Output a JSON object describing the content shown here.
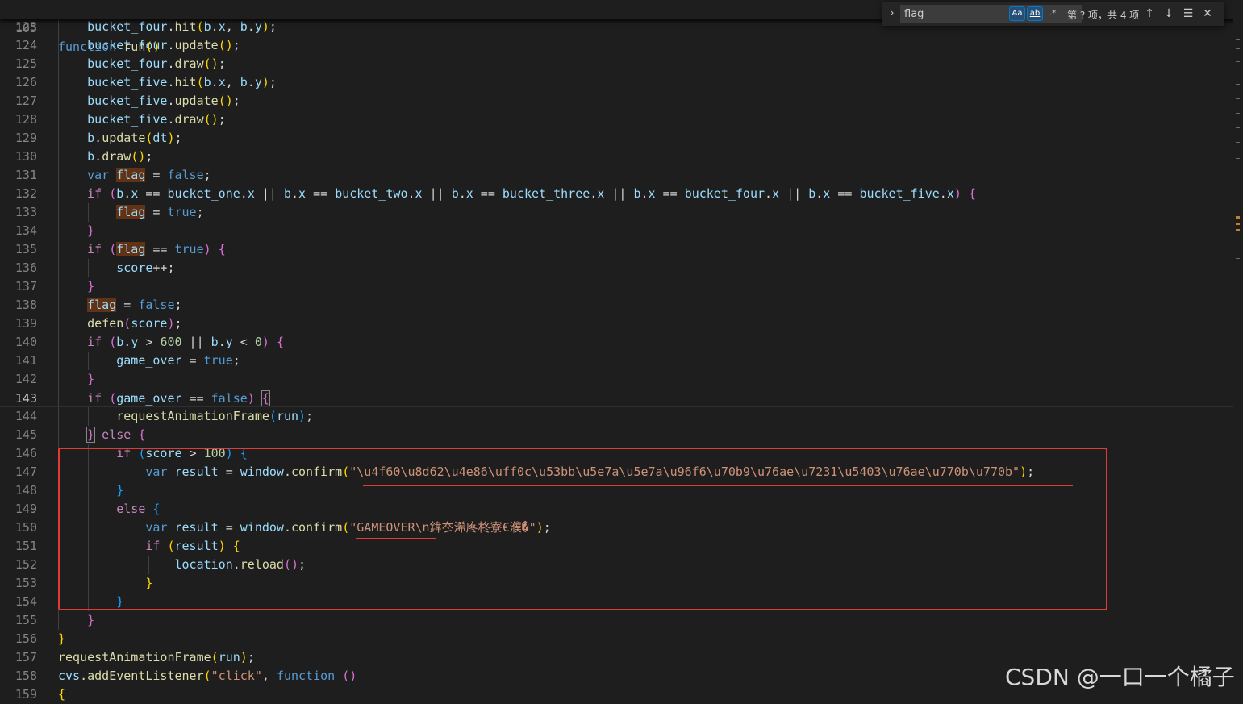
{
  "sticky": {
    "line": "105",
    "keyword": "function",
    "name": "run",
    "parens": "()"
  },
  "lines": [
    {
      "n": "123",
      "indent": 1,
      "tokens": [
        [
          "var",
          "bucket_four"
        ],
        [
          "op",
          "."
        ],
        [
          "fn",
          "hit"
        ],
        [
          "br1",
          "("
        ],
        [
          "var",
          "b"
        ],
        [
          "op",
          "."
        ],
        [
          "var",
          "x"
        ],
        [
          "op",
          ", "
        ],
        [
          "var",
          "b"
        ],
        [
          "op",
          "."
        ],
        [
          "var",
          "y"
        ],
        [
          "br1",
          ")"
        ],
        [
          "op",
          ";"
        ]
      ]
    },
    {
      "n": "124",
      "indent": 1,
      "tokens": [
        [
          "var",
          "bucket_four"
        ],
        [
          "op",
          "."
        ],
        [
          "fn",
          "update"
        ],
        [
          "br1",
          "()"
        ],
        [
          "op",
          ";"
        ]
      ]
    },
    {
      "n": "125",
      "indent": 1,
      "tokens": [
        [
          "var",
          "bucket_four"
        ],
        [
          "op",
          "."
        ],
        [
          "fn",
          "draw"
        ],
        [
          "br1",
          "()"
        ],
        [
          "op",
          ";"
        ]
      ]
    },
    {
      "n": "126",
      "indent": 1,
      "tokens": [
        [
          "var",
          "bucket_five"
        ],
        [
          "op",
          "."
        ],
        [
          "fn",
          "hit"
        ],
        [
          "br1",
          "("
        ],
        [
          "var",
          "b"
        ],
        [
          "op",
          "."
        ],
        [
          "var",
          "x"
        ],
        [
          "op",
          ", "
        ],
        [
          "var",
          "b"
        ],
        [
          "op",
          "."
        ],
        [
          "var",
          "y"
        ],
        [
          "br1",
          ")"
        ],
        [
          "op",
          ";"
        ]
      ]
    },
    {
      "n": "127",
      "indent": 1,
      "tokens": [
        [
          "var",
          "bucket_five"
        ],
        [
          "op",
          "."
        ],
        [
          "fn",
          "update"
        ],
        [
          "br1",
          "()"
        ],
        [
          "op",
          ";"
        ]
      ]
    },
    {
      "n": "128",
      "indent": 1,
      "tokens": [
        [
          "var",
          "bucket_five"
        ],
        [
          "op",
          "."
        ],
        [
          "fn",
          "draw"
        ],
        [
          "br1",
          "()"
        ],
        [
          "op",
          ";"
        ]
      ]
    },
    {
      "n": "129",
      "indent": 1,
      "tokens": [
        [
          "var",
          "b"
        ],
        [
          "op",
          "."
        ],
        [
          "fn",
          "update"
        ],
        [
          "br1",
          "("
        ],
        [
          "var",
          "dt"
        ],
        [
          "br1",
          ")"
        ],
        [
          "op",
          ";"
        ]
      ]
    },
    {
      "n": "130",
      "indent": 1,
      "tokens": [
        [
          "var",
          "b"
        ],
        [
          "op",
          "."
        ],
        [
          "fn",
          "draw"
        ],
        [
          "br1",
          "()"
        ],
        [
          "op",
          ";"
        ]
      ]
    },
    {
      "n": "131",
      "indent": 1,
      "tokens": [
        [
          "kw",
          "var "
        ],
        [
          "var-hl",
          "flag"
        ],
        [
          "op",
          " = "
        ],
        [
          "kw",
          "false"
        ],
        [
          "op",
          ";"
        ]
      ]
    },
    {
      "n": "132",
      "indent": 1,
      "tokens": [
        [
          "ctl",
          "if "
        ],
        [
          "br2",
          "("
        ],
        [
          "var",
          "b"
        ],
        [
          "op",
          "."
        ],
        [
          "var",
          "x"
        ],
        [
          "op",
          " == "
        ],
        [
          "var",
          "bucket_one"
        ],
        [
          "op",
          "."
        ],
        [
          "var",
          "x"
        ],
        [
          "op",
          " || "
        ],
        [
          "var",
          "b"
        ],
        [
          "op",
          "."
        ],
        [
          "var",
          "x"
        ],
        [
          "op",
          " == "
        ],
        [
          "var",
          "bucket_two"
        ],
        [
          "op",
          "."
        ],
        [
          "var",
          "x"
        ],
        [
          "op",
          " || "
        ],
        [
          "var",
          "b"
        ],
        [
          "op",
          "."
        ],
        [
          "var",
          "x"
        ],
        [
          "op",
          " == "
        ],
        [
          "var",
          "bucket_three"
        ],
        [
          "op",
          "."
        ],
        [
          "var",
          "x"
        ],
        [
          "op",
          " || "
        ],
        [
          "var",
          "b"
        ],
        [
          "op",
          "."
        ],
        [
          "var",
          "x"
        ],
        [
          "op",
          " == "
        ],
        [
          "var",
          "bucket_four"
        ],
        [
          "op",
          "."
        ],
        [
          "var",
          "x"
        ],
        [
          "op",
          " || "
        ],
        [
          "var",
          "b"
        ],
        [
          "op",
          "."
        ],
        [
          "var",
          "x"
        ],
        [
          "op",
          " == "
        ],
        [
          "var",
          "bucket_five"
        ],
        [
          "op",
          "."
        ],
        [
          "var",
          "x"
        ],
        [
          "br2",
          ")"
        ],
        [
          "op",
          " "
        ],
        [
          "br2",
          "{"
        ]
      ]
    },
    {
      "n": "133",
      "indent": 2,
      "tokens": [
        [
          "var-hl",
          "flag"
        ],
        [
          "op",
          " = "
        ],
        [
          "kw",
          "true"
        ],
        [
          "op",
          ";"
        ]
      ]
    },
    {
      "n": "134",
      "indent": 1,
      "tokens": [
        [
          "br2",
          "}"
        ]
      ]
    },
    {
      "n": "135",
      "indent": 1,
      "tokens": [
        [
          "ctl",
          "if "
        ],
        [
          "br2",
          "("
        ],
        [
          "var-hl",
          "flag"
        ],
        [
          "op",
          " == "
        ],
        [
          "kw",
          "true"
        ],
        [
          "br2",
          ")"
        ],
        [
          "op",
          " "
        ],
        [
          "br2",
          "{"
        ]
      ]
    },
    {
      "n": "136",
      "indent": 2,
      "tokens": [
        [
          "var",
          "score"
        ],
        [
          "op",
          "++;"
        ]
      ]
    },
    {
      "n": "137",
      "indent": 1,
      "tokens": [
        [
          "br2",
          "}"
        ]
      ]
    },
    {
      "n": "138",
      "indent": 1,
      "tokens": [
        [
          "var-hl",
          "flag"
        ],
        [
          "op",
          " = "
        ],
        [
          "kw",
          "false"
        ],
        [
          "op",
          ";"
        ]
      ]
    },
    {
      "n": "139",
      "indent": 1,
      "tokens": [
        [
          "fn",
          "defen"
        ],
        [
          "br2",
          "("
        ],
        [
          "var",
          "score"
        ],
        [
          "br2",
          ")"
        ],
        [
          "op",
          ";"
        ]
      ]
    },
    {
      "n": "140",
      "indent": 1,
      "tokens": [
        [
          "ctl",
          "if "
        ],
        [
          "br2",
          "("
        ],
        [
          "var",
          "b"
        ],
        [
          "op",
          "."
        ],
        [
          "var",
          "y"
        ],
        [
          "op",
          " > "
        ],
        [
          "num",
          "600"
        ],
        [
          "op",
          " || "
        ],
        [
          "var",
          "b"
        ],
        [
          "op",
          "."
        ],
        [
          "var",
          "y"
        ],
        [
          "op",
          " < "
        ],
        [
          "num",
          "0"
        ],
        [
          "br2",
          ")"
        ],
        [
          "op",
          " "
        ],
        [
          "br2",
          "{"
        ]
      ]
    },
    {
      "n": "141",
      "indent": 2,
      "tokens": [
        [
          "var",
          "game_over"
        ],
        [
          "op",
          " = "
        ],
        [
          "kw",
          "true"
        ],
        [
          "op",
          ";"
        ]
      ]
    },
    {
      "n": "142",
      "indent": 1,
      "tokens": [
        [
          "br2",
          "}"
        ]
      ]
    },
    {
      "n": "143",
      "indent": 1,
      "active": true,
      "tokens": [
        [
          "ctl",
          "if "
        ],
        [
          "br2",
          "("
        ],
        [
          "var",
          "game_over"
        ],
        [
          "op",
          " == "
        ],
        [
          "kw",
          "false"
        ],
        [
          "br2",
          ")"
        ],
        [
          "op",
          " "
        ],
        [
          "br2-m",
          "{"
        ]
      ]
    },
    {
      "n": "144",
      "indent": 2,
      "tokens": [
        [
          "fn",
          "requestAnimationFrame"
        ],
        [
          "br3",
          "("
        ],
        [
          "var",
          "run"
        ],
        [
          "br3",
          ")"
        ],
        [
          "op",
          ";"
        ]
      ]
    },
    {
      "n": "145",
      "indent": 1,
      "tokens": [
        [
          "br2-m",
          "}"
        ],
        [
          "ctl",
          " else "
        ],
        [
          "br2",
          "{"
        ]
      ]
    },
    {
      "n": "146",
      "indent": 2,
      "tokens": [
        [
          "ctl",
          "if "
        ],
        [
          "br3",
          "("
        ],
        [
          "var",
          "score"
        ],
        [
          "op",
          " > "
        ],
        [
          "num",
          "100"
        ],
        [
          "br3",
          ")"
        ],
        [
          "op",
          " "
        ],
        [
          "br3",
          "{"
        ]
      ]
    },
    {
      "n": "147",
      "indent": 3,
      "tokens": [
        [
          "kw",
          "var "
        ],
        [
          "var",
          "result"
        ],
        [
          "op",
          " = "
        ],
        [
          "var",
          "window"
        ],
        [
          "op",
          "."
        ],
        [
          "fn",
          "confirm"
        ],
        [
          "br1",
          "("
        ],
        [
          "str",
          "\"\\u4f60\\u8d62\\u4e86\\uff0c\\u53bb\\u5e7a\\u5e7a\\u96f6\\u70b9\\u76ae\\u7231\\u5403\\u76ae\\u770b\\u770b\""
        ],
        [
          "br1",
          ")"
        ],
        [
          "op",
          ";"
        ]
      ]
    },
    {
      "n": "148",
      "indent": 2,
      "tokens": [
        [
          "br3",
          "}"
        ]
      ]
    },
    {
      "n": "149",
      "indent": 2,
      "tokens": [
        [
          "ctl",
          "else "
        ],
        [
          "br3",
          "{"
        ]
      ]
    },
    {
      "n": "150",
      "indent": 3,
      "tokens": [
        [
          "kw",
          "var "
        ],
        [
          "var",
          "result"
        ],
        [
          "op",
          " = "
        ],
        [
          "var",
          "window"
        ],
        [
          "op",
          "."
        ],
        [
          "fn",
          "confirm"
        ],
        [
          "br1",
          "("
        ],
        [
          "str",
          "\"GAMEOVER\\n鍏冭浠庝柊寮€濮�\""
        ],
        [
          "br1",
          ")"
        ],
        [
          "op",
          ";"
        ]
      ]
    },
    {
      "n": "151",
      "indent": 3,
      "tokens": [
        [
          "ctl",
          "if "
        ],
        [
          "br1",
          "("
        ],
        [
          "var",
          "result"
        ],
        [
          "br1",
          ")"
        ],
        [
          "op",
          " "
        ],
        [
          "br1",
          "{"
        ]
      ]
    },
    {
      "n": "152",
      "indent": 4,
      "tokens": [
        [
          "var",
          "location"
        ],
        [
          "op",
          "."
        ],
        [
          "fn",
          "reload"
        ],
        [
          "br2",
          "()"
        ],
        [
          "op",
          ";"
        ]
      ]
    },
    {
      "n": "153",
      "indent": 3,
      "tokens": [
        [
          "br1",
          "}"
        ]
      ]
    },
    {
      "n": "154",
      "indent": 2,
      "tokens": [
        [
          "br3",
          "}"
        ]
      ]
    },
    {
      "n": "155",
      "indent": 1,
      "tokens": [
        [
          "br2",
          "}"
        ]
      ]
    },
    {
      "n": "156",
      "indent": 0,
      "tokens": [
        [
          "br1",
          "}"
        ]
      ]
    },
    {
      "n": "157",
      "indent": 0,
      "tokens": [
        [
          "fn",
          "requestAnimationFrame"
        ],
        [
          "br1",
          "("
        ],
        [
          "var",
          "run"
        ],
        [
          "br1",
          ")"
        ],
        [
          "op",
          ";"
        ]
      ]
    },
    {
      "n": "158",
      "indent": 0,
      "tokens": [
        [
          "var",
          "cvs"
        ],
        [
          "op",
          "."
        ],
        [
          "fn",
          "addEventListener"
        ],
        [
          "br1",
          "("
        ],
        [
          "str",
          "\"click\""
        ],
        [
          "op",
          ", "
        ],
        [
          "kw",
          "function "
        ],
        [
          "br2",
          "()"
        ]
      ]
    },
    {
      "n": "159",
      "indent": 0,
      "tokens": [
        [
          "br1",
          "{"
        ]
      ]
    }
  ],
  "find": {
    "toggle_icon": "›",
    "query": "flag",
    "match_case": "Aa",
    "whole_word": "ab",
    "regex": ".*",
    "match_count": "第 ? 项，共 4 项",
    "prev_icon": "↑",
    "next_icon": "↓",
    "selection_icon": "☰",
    "close_icon": "✕"
  },
  "watermark": "CSDN @一口一个橘子"
}
